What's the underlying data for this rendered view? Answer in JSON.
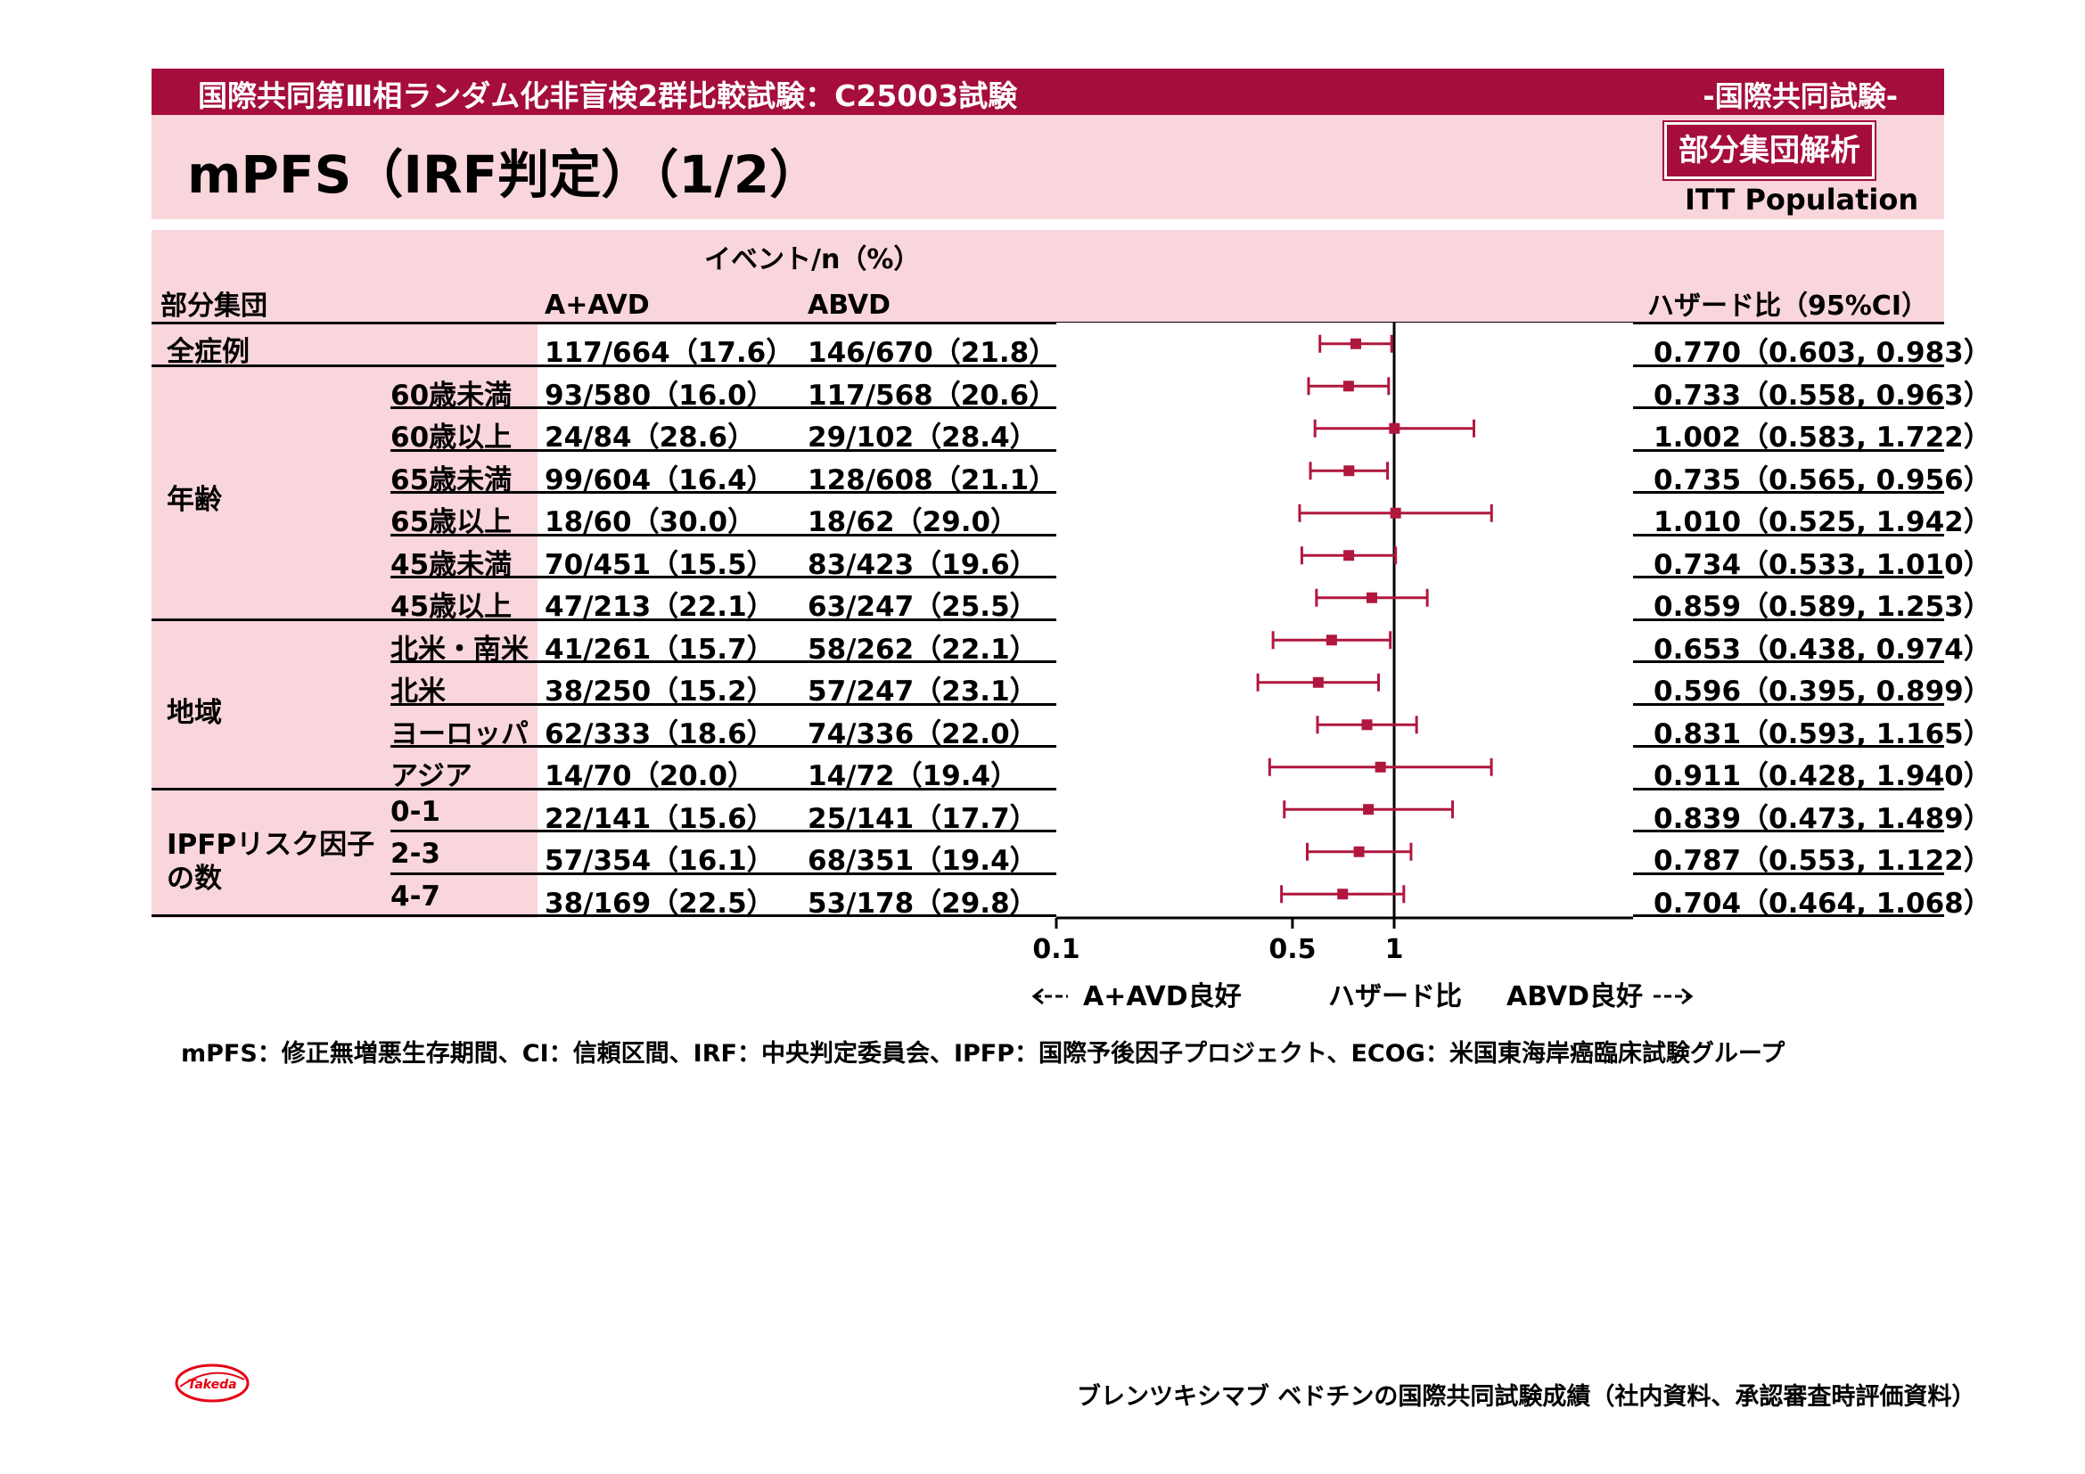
{
  "header": {
    "study_title": "国際共同第Ⅲ相ランダム化非盲検2群比較試験：C25003試験",
    "study_tag": "-国際共同試験-",
    "page_title": "mPFS（IRF判定）（1/2）",
    "badge": "部分集団解析",
    "population": "ITT Population"
  },
  "table": {
    "header_events": "イベント/n（%）",
    "header_subgroup": "部分集団",
    "header_arm1": "A+AVD",
    "header_arm2": "ABVD",
    "header_hr": "ハザード比（95%CI）",
    "groups": [
      {
        "label": "全症例",
        "rows": [
          0
        ]
      },
      {
        "label": "年齢",
        "rows": [
          1,
          2,
          3,
          4,
          5,
          6
        ]
      },
      {
        "label": "地域",
        "rows": [
          7,
          8,
          9,
          10
        ]
      },
      {
        "label": "IPFPリスク因子の数",
        "label_line1": "IPFPリスク因子",
        "label_line2": "の数",
        "rows": [
          11,
          12,
          13
        ]
      }
    ],
    "rows": [
      {
        "group": "全症例",
        "sub": "",
        "arm1": "117/664（17.6）",
        "arm2": "146/670（21.8）",
        "hr_text": "0.770（0.603, 0.983）"
      },
      {
        "group": "年齢",
        "sub": "60歳未満",
        "arm1": "93/580（16.0）",
        "arm2": "117/568（20.6）",
        "hr_text": "0.733（0.558, 0.963）"
      },
      {
        "group": "年齢",
        "sub": "60歳以上",
        "arm1": "24/84（28.6）",
        "arm2": "29/102（28.4）",
        "hr_text": "1.002（0.583, 1.722）"
      },
      {
        "group": "年齢",
        "sub": "65歳未満",
        "arm1": "99/604（16.4）",
        "arm2": "128/608（21.1）",
        "hr_text": "0.735（0.565, 0.956）"
      },
      {
        "group": "年齢",
        "sub": "65歳以上",
        "arm1": "18/60（30.0）",
        "arm2": "18/62（29.0）",
        "hr_text": "1.010（0.525, 1.942）"
      },
      {
        "group": "年齢",
        "sub": "45歳未満",
        "arm1": "70/451（15.5）",
        "arm2": "83/423（19.6）",
        "hr_text": "0.734（0.533, 1.010）"
      },
      {
        "group": "年齢",
        "sub": "45歳以上",
        "arm1": "47/213（22.1）",
        "arm2": "63/247（25.5）",
        "hr_text": "0.859（0.589, 1.253）"
      },
      {
        "group": "地域",
        "sub": "北米・南米",
        "arm1": "41/261（15.7）",
        "arm2": "58/262（22.1）",
        "hr_text": "0.653（0.438, 0.974）"
      },
      {
        "group": "地域",
        "sub": "北米",
        "arm1": "38/250（15.2）",
        "arm2": "57/247（23.1）",
        "hr_text": "0.596（0.395, 0.899）"
      },
      {
        "group": "地域",
        "sub": "ヨーロッパ",
        "arm1": "62/333（18.6）",
        "arm2": "74/336（22.0）",
        "hr_text": "0.831（0.593, 1.165）"
      },
      {
        "group": "地域",
        "sub": "アジア",
        "arm1": "14/70（20.0）",
        "arm2": "14/72（19.4）",
        "hr_text": "0.911（0.428, 1.940）"
      },
      {
        "group": "IPFPリスク因子の数",
        "sub": "0-1",
        "arm1": "22/141（15.6）",
        "arm2": "25/141（17.7）",
        "hr_text": "0.839（0.473, 1.489）"
      },
      {
        "group": "IPFPリスク因子の数",
        "sub": "2-3",
        "arm1": "57/354（16.1）",
        "arm2": "68/351（19.4）",
        "hr_text": "0.787（0.553, 1.122）"
      },
      {
        "group": "IPFPリスク因子の数",
        "sub": "4-7",
        "arm1": "38/169（22.5）",
        "arm2": "53/178（29.8）",
        "hr_text": "0.704（0.464, 1.068）"
      }
    ]
  },
  "chart_data": {
    "type": "forest",
    "scale": "log",
    "xlim": [
      0.1,
      3
    ],
    "ticks": [
      0.1,
      0.5,
      1
    ],
    "tick_labels": [
      "0.1",
      "0.5",
      "1"
    ],
    "reference_line": 1,
    "xlabel_left": "A+AVD良好",
    "xlabel": "ハザード比",
    "xlabel_right": "ABVD良好",
    "marker_color": "#b0173f",
    "points": [
      {
        "label": "全症例",
        "hr": 0.77,
        "lo": 0.603,
        "hi": 0.983
      },
      {
        "label": "60歳未満",
        "hr": 0.733,
        "lo": 0.558,
        "hi": 0.963
      },
      {
        "label": "60歳以上",
        "hr": 1.002,
        "lo": 0.583,
        "hi": 1.722
      },
      {
        "label": "65歳未満",
        "hr": 0.735,
        "lo": 0.565,
        "hi": 0.956
      },
      {
        "label": "65歳以上",
        "hr": 1.01,
        "lo": 0.525,
        "hi": 1.942
      },
      {
        "label": "45歳未満",
        "hr": 0.734,
        "lo": 0.533,
        "hi": 1.01
      },
      {
        "label": "45歳以上",
        "hr": 0.859,
        "lo": 0.589,
        "hi": 1.253
      },
      {
        "label": "北米・南米",
        "hr": 0.653,
        "lo": 0.438,
        "hi": 0.974
      },
      {
        "label": "北米",
        "hr": 0.596,
        "lo": 0.395,
        "hi": 0.899
      },
      {
        "label": "ヨーロッパ",
        "hr": 0.831,
        "lo": 0.593,
        "hi": 1.165
      },
      {
        "label": "アジア",
        "hr": 0.911,
        "lo": 0.428,
        "hi": 1.94
      },
      {
        "label": "0-1",
        "hr": 0.839,
        "lo": 0.473,
        "hi": 1.489
      },
      {
        "label": "2-3",
        "hr": 0.787,
        "lo": 0.553,
        "hi": 1.122
      },
      {
        "label": "4-7",
        "hr": 0.704,
        "lo": 0.464,
        "hi": 1.068
      }
    ]
  },
  "footnote": "mPFS：修正無増悪生存期間、CI：信頼区間、IRF：中央判定委員会、IPFP：国際予後因子プロジェクト、ECOG：米国東海岸癌臨床試験グループ",
  "source": "ブレンツキシマブ ベドチンの国際共同試験成績（社内資料、承認審査時評価資料）",
  "logo_text": "Takeda",
  "colors": {
    "brand": "#a50d3c",
    "band": "#f9d5dc",
    "marker": "#b0173f"
  }
}
